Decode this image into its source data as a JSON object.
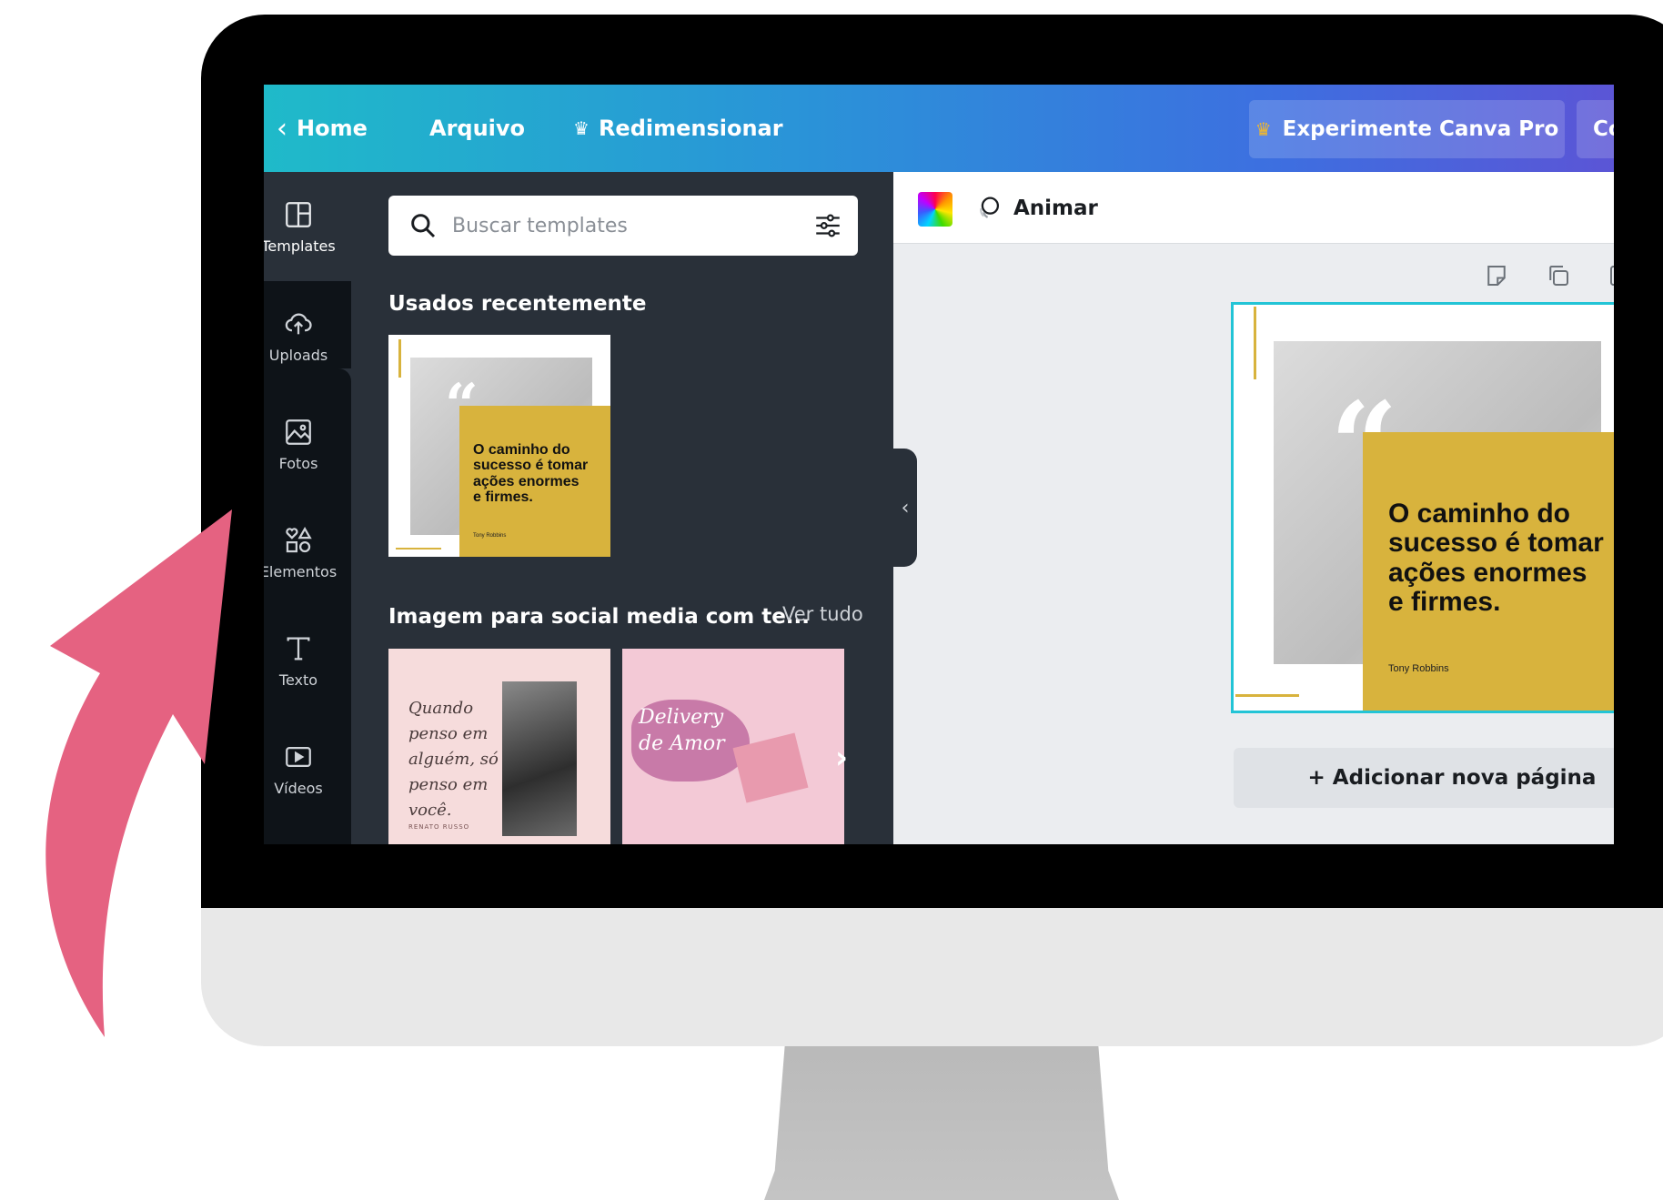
{
  "topbar": {
    "home": "Home",
    "file": "Arquivo",
    "resize": "Redimensionar",
    "pro_button": "Experimente Canva Pro",
    "share_button_partial": "Co"
  },
  "sidebar": {
    "items": [
      {
        "label": "Templates",
        "icon": "templates-icon"
      },
      {
        "label": "Uploads",
        "icon": "upload-cloud-icon"
      },
      {
        "label": "Fotos",
        "icon": "photo-icon"
      },
      {
        "label": "Elementos",
        "icon": "shapes-icon"
      },
      {
        "label": "Texto",
        "icon": "text-icon"
      },
      {
        "label": "Vídeos",
        "icon": "video-icon"
      }
    ]
  },
  "panel": {
    "search_placeholder": "Buscar templates",
    "recent_title": "Usados recentemente",
    "social_title": "Imagem para social media com te...",
    "see_all": "Ver tudo",
    "recent_template": {
      "quote": "O caminho do\nsucesso é tomar\nações enormes\ne firmes.",
      "author": "Tony Robbins"
    },
    "social_templates": [
      {
        "text": "Quando\npenso em\nalguém, só\npenso em\nvocê.",
        "author": "RENATO RUSSO"
      },
      {
        "text": "Delivery\nde Amor"
      }
    ]
  },
  "editor": {
    "animate": "Animar",
    "add_page": "+ Adicionar nova página",
    "page": {
      "quote": "O caminho do\nsucesso é tomar\nações enormes\ne firmes.",
      "author": "Tony Robbins"
    }
  },
  "colors": {
    "accent_gold": "#d8b33d",
    "selection": "#23c4d6",
    "annotation_arrow": "#e56281"
  }
}
